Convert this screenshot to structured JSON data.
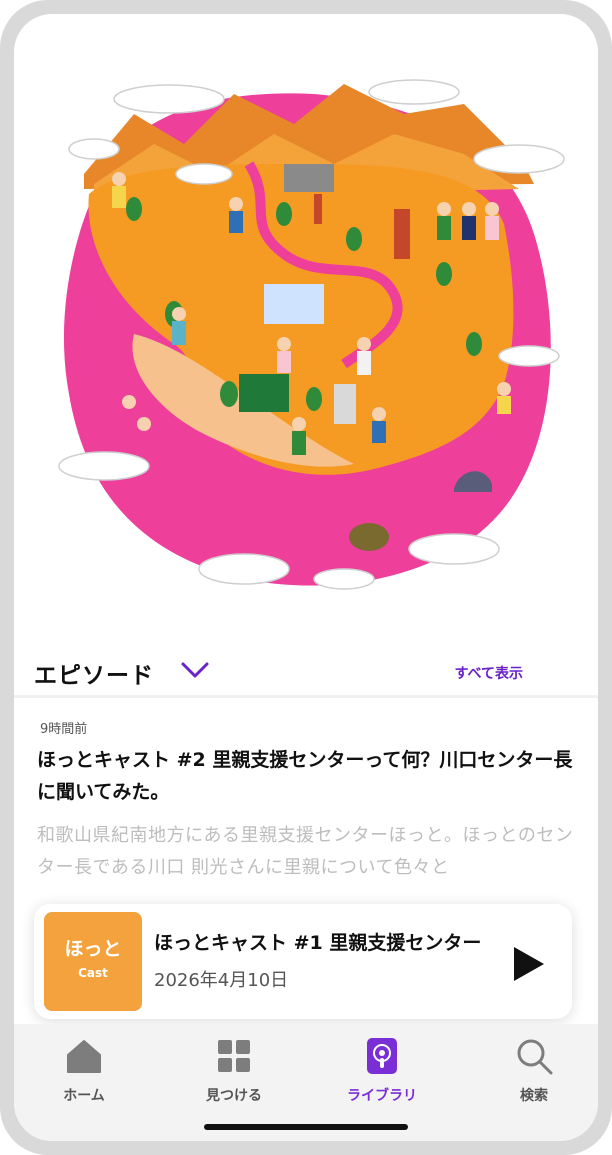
{
  "episodes_section": {
    "title": "エピソード",
    "see_all": "すべて表示"
  },
  "episode": {
    "time_ago": "9時間前",
    "title": "ほっとキャスト #2 里親支援センターって何？川口センター長に聞いてみた。",
    "description": "和歌山県紀南地方にある里親支援センターほっと。ほっとのセンター長である川口 則光さんに里親について色々と"
  },
  "mini_player": {
    "cover_title": "ほっと",
    "cover_subtitle": "Cast",
    "title": "ほっとキャスト #1  里親支援センター",
    "date": "2026年4月10日"
  },
  "tabs": [
    {
      "label": "ホーム",
      "icon": "home-icon",
      "active": false
    },
    {
      "label": "見つける",
      "icon": "grid-icon",
      "active": false
    },
    {
      "label": "ライブラリ",
      "icon": "podcast-icon",
      "active": true
    },
    {
      "label": "検索",
      "icon": "search-icon",
      "active": false
    }
  ],
  "colors": {
    "accent": "#7a2fd6",
    "map_pink": "#ee3f9b",
    "map_orange": "#f59a22",
    "cover": "#f4a23d"
  }
}
